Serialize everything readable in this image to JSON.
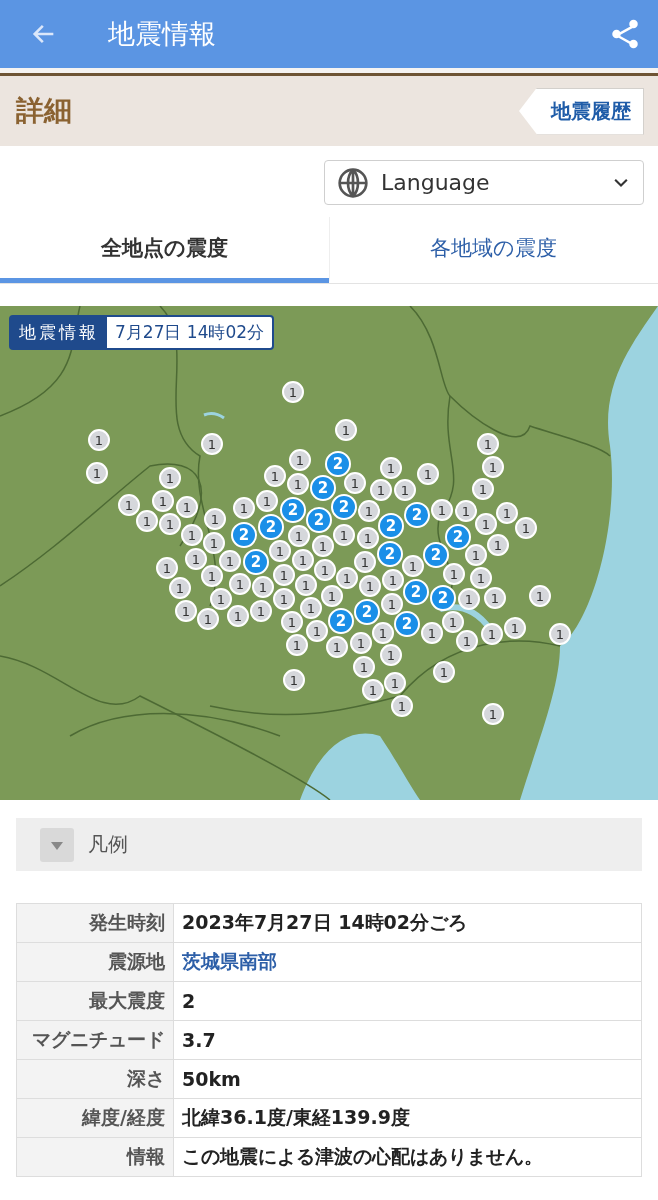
{
  "app_bar": {
    "title": "地震情報"
  },
  "section": {
    "title": "詳細",
    "history_button": "地震履歴"
  },
  "language_select": {
    "value": "Language"
  },
  "tabs": [
    {
      "label": "全地点の震度",
      "selected": true
    },
    {
      "label": "各地域の震度",
      "selected": false
    }
  ],
  "map": {
    "badge_title": "地震情報",
    "badge_time": "7月27日 14時02分",
    "markers": [
      {
        "label": "1",
        "color": "#d5d7db"
      },
      {
        "label": "1",
        "color": "#d5d7db"
      },
      {
        "label": "1",
        "color": "#d5d7db"
      },
      {
        "label": "1",
        "color": "#d5d7db"
      },
      {
        "label": "1",
        "color": "#d5d7db"
      },
      {
        "label": "1",
        "color": "#d5d7db"
      },
      {
        "label": "1",
        "color": "#d5d7db"
      },
      {
        "label": "1",
        "color": "#d5d7db"
      },
      {
        "label": "1",
        "color": "#d5d7db"
      },
      {
        "label": "1",
        "color": "#d5d7db"
      },
      {
        "label": "1",
        "color": "#d5d7db"
      },
      {
        "label": "1",
        "color": "#d5d7db"
      },
      {
        "label": "1",
        "color": "#d5d7db"
      },
      {
        "label": "1",
        "color": "#d5d7db"
      },
      {
        "label": "1",
        "color": "#d5d7db"
      },
      {
        "label": "1",
        "color": "#d5d7db"
      },
      {
        "label": "1",
        "color": "#d5d7db"
      },
      {
        "label": "1",
        "color": "#d5d7db"
      },
      {
        "label": "1",
        "color": "#d5d7db"
      },
      {
        "label": "1",
        "color": "#d5d7db"
      },
      {
        "label": "1",
        "color": "#d5d7db"
      },
      {
        "label": "1",
        "color": "#d5d7db"
      },
      {
        "label": "1",
        "color": "#d5d7db"
      },
      {
        "label": "1",
        "color": "#d5d7db"
      },
      {
        "label": "1",
        "color": "#d5d7db"
      },
      {
        "label": "1",
        "color": "#d5d7db"
      },
      {
        "label": "1",
        "color": "#d5d7db"
      },
      {
        "label": "1",
        "color": "#d5d7db"
      },
      {
        "label": "1",
        "color": "#d5d7db"
      },
      {
        "label": "1",
        "color": "#d5d7db"
      },
      {
        "label": "1",
        "color": "#d5d7db"
      },
      {
        "label": "1",
        "color": "#d5d7db"
      },
      {
        "label": "1",
        "color": "#d5d7db"
      },
      {
        "label": "1",
        "color": "#d5d7db"
      },
      {
        "label": "1",
        "color": "#d5d7db"
      },
      {
        "label": "1",
        "color": "#d5d7db"
      },
      {
        "label": "1",
        "color": "#d5d7db"
      },
      {
        "label": "1",
        "color": "#d5d7db"
      },
      {
        "label": "1",
        "color": "#d5d7db"
      },
      {
        "label": "1",
        "color": "#d5d7db"
      },
      {
        "label": "1",
        "color": "#d5d7db"
      },
      {
        "label": "1",
        "color": "#d5d7db"
      },
      {
        "label": "1",
        "color": "#d5d7db"
      },
      {
        "label": "1",
        "color": "#d5d7db"
      },
      {
        "label": "1",
        "color": "#d5d7db"
      },
      {
        "label": "1",
        "color": "#d5d7db"
      },
      {
        "label": "1",
        "color": "#d5d7db"
      },
      {
        "label": "1",
        "color": "#d5d7db"
      },
      {
        "label": "1",
        "color": "#d5d7db"
      },
      {
        "label": "1",
        "color": "#d5d7db"
      },
      {
        "label": "1",
        "color": "#d5d7db"
      },
      {
        "label": "1",
        "color": "#d5d7db"
      },
      {
        "label": "1",
        "color": "#d5d7db"
      },
      {
        "label": "1",
        "color": "#d5d7db"
      },
      {
        "label": "1",
        "color": "#d5d7db"
      },
      {
        "label": "1",
        "color": "#d5d7db"
      },
      {
        "label": "1",
        "color": "#d5d7db"
      },
      {
        "label": "1",
        "color": "#d5d7db"
      },
      {
        "label": "1",
        "color": "#d5d7db"
      },
      {
        "label": "1",
        "color": "#d5d7db"
      },
      {
        "label": "1",
        "color": "#d5d7db"
      },
      {
        "label": "1",
        "color": "#d5d7db"
      },
      {
        "label": "1",
        "color": "#d5d7db"
      },
      {
        "label": "1",
        "color": "#d5d7db"
      },
      {
        "label": "1",
        "color": "#d5d7db"
      },
      {
        "label": "1",
        "color": "#d5d7db"
      },
      {
        "label": "1",
        "color": "#d5d7db"
      },
      {
        "label": "1",
        "color": "#d5d7db"
      },
      {
        "label": "1",
        "color": "#d5d7db"
      },
      {
        "label": "1",
        "color": "#d5d7db"
      },
      {
        "label": "1",
        "color": "#d5d7db"
      },
      {
        "label": "1",
        "color": "#d5d7db"
      },
      {
        "label": "1",
        "color": "#d5d7db"
      },
      {
        "label": "1",
        "color": "#d5d7db"
      },
      {
        "label": "1",
        "color": "#d5d7db"
      },
      {
        "label": "1",
        "color": "#d5d7db"
      },
      {
        "label": "1",
        "color": "#d5d7db"
      },
      {
        "label": "1",
        "color": "#d5d7db"
      },
      {
        "label": "1",
        "color": "#d5d7db"
      },
      {
        "label": "1",
        "color": "#d5d7db"
      },
      {
        "label": "1",
        "color": "#d5d7db"
      },
      {
        "label": "1",
        "color": "#d5d7db"
      },
      {
        "label": "1",
        "color": "#d5d7db"
      },
      {
        "label": "1",
        "color": "#d5d7db"
      },
      {
        "label": "1",
        "color": "#d5d7db"
      },
      {
        "label": "1",
        "color": "#d5d7db"
      },
      {
        "label": "1",
        "color": "#d5d7db"
      },
      {
        "label": "1",
        "color": "#d5d7db"
      },
      {
        "label": "1",
        "color": "#d5d7db"
      },
      {
        "label": "1",
        "color": "#d5d7db"
      },
      {
        "label": "2",
        "color": "#1a8fe8"
      },
      {
        "label": "2",
        "color": "#1a8fe8"
      },
      {
        "label": "2",
        "color": "#1a8fe8"
      },
      {
        "label": "2",
        "color": "#1a8fe8"
      },
      {
        "label": "2",
        "color": "#1a8fe8"
      },
      {
        "label": "2",
        "color": "#1a8fe8"
      },
      {
        "label": "2",
        "color": "#1a8fe8"
      },
      {
        "label": "2",
        "color": "#1a8fe8"
      },
      {
        "label": "2",
        "color": "#1a8fe8"
      },
      {
        "label": "2",
        "color": "#1a8fe8"
      },
      {
        "label": "2",
        "color": "#1a8fe8"
      },
      {
        "label": "2",
        "color": "#1a8fe8"
      },
      {
        "label": "2",
        "color": "#1a8fe8"
      },
      {
        "label": "2",
        "color": "#1a8fe8"
      },
      {
        "label": "2",
        "color": "#1a8fe8"
      },
      {
        "label": "2",
        "color": "#1a8fe8"
      },
      {
        "label": "2",
        "color": "#1a8fe8"
      },
      {
        "label": "2",
        "color": "#1a8fe8"
      }
    ]
  },
  "legend": {
    "label": "凡例",
    "expanded": false
  },
  "details": [
    {
      "label": "発生時刻",
      "value": "2023年7月27日 14時02分ごろ",
      "kind": "text"
    },
    {
      "label": "震源地",
      "value": "茨城県南部",
      "kind": "link"
    },
    {
      "label": "最大震度",
      "value": "2",
      "kind": "text"
    },
    {
      "label": "マグニチュード",
      "value": "3.7",
      "kind": "text"
    },
    {
      "label": "深さ",
      "value": "50km",
      "kind": "text"
    },
    {
      "label": "緯度/経度",
      "value": "北緯36.1度/東経139.9度",
      "kind": "text"
    },
    {
      "label": "情報",
      "value": "この地震による津波の心配はありません。",
      "kind": "text"
    }
  ]
}
